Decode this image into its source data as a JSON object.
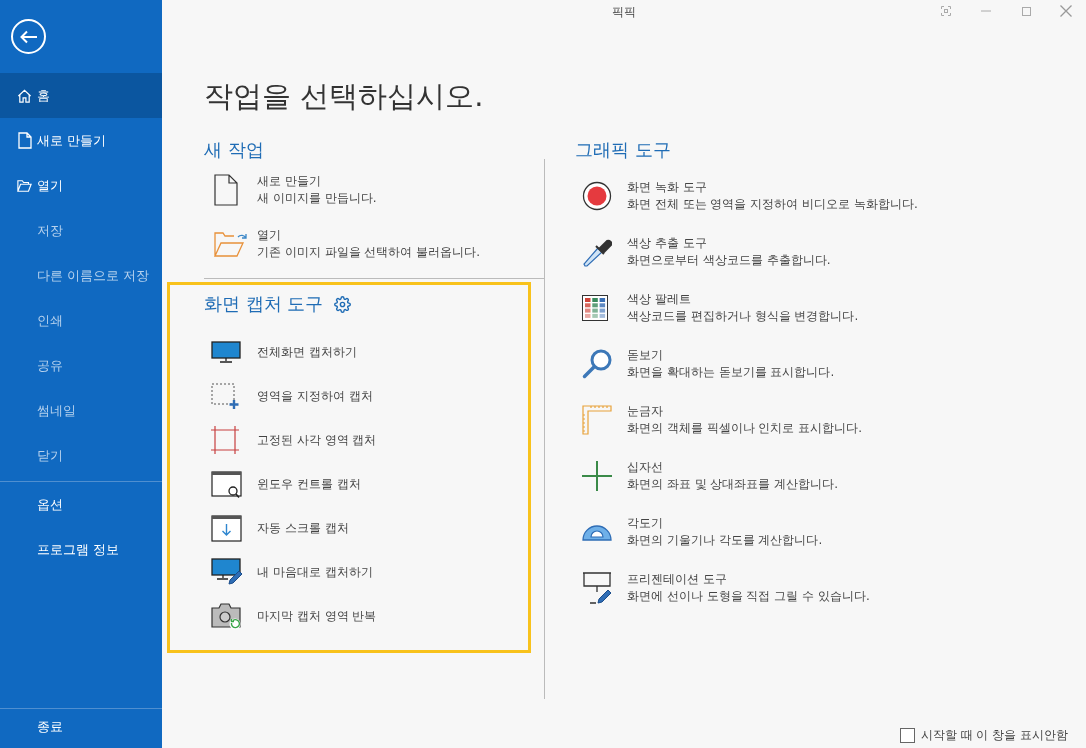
{
  "window": {
    "title": "픽픽"
  },
  "sidebar": {
    "items": [
      {
        "label": "홈",
        "kind": "home",
        "selected": true,
        "disabled": false
      },
      {
        "label": "새로 만들기",
        "kind": "file",
        "selected": false,
        "disabled": false
      },
      {
        "label": "열기",
        "kind": "folder",
        "selected": false,
        "disabled": false
      },
      {
        "label": "저장",
        "kind": "plain",
        "selected": false,
        "disabled": true
      },
      {
        "label": "다른 이름으로 저장",
        "kind": "plain",
        "selected": false,
        "disabled": true
      },
      {
        "label": "인쇄",
        "kind": "plain",
        "selected": false,
        "disabled": true
      },
      {
        "label": "공유",
        "kind": "plain",
        "selected": false,
        "disabled": true
      },
      {
        "label": "썸네일",
        "kind": "plain",
        "selected": false,
        "disabled": true
      },
      {
        "label": "닫기",
        "kind": "plain",
        "selected": false,
        "disabled": true
      },
      {
        "label": "옵션",
        "kind": "divided",
        "selected": false,
        "disabled": false
      },
      {
        "label": "프로그램 정보",
        "kind": "plain",
        "selected": false,
        "disabled": false
      }
    ],
    "exit": "종료"
  },
  "heading": "작업을 선택하십시오.",
  "new_task": {
    "title": "새 작업",
    "items": [
      {
        "kind": "file",
        "title": "새로 만들기",
        "description": "새 이미지를 만듭니다."
      },
      {
        "kind": "folder",
        "title": "열기",
        "description": "기존 이미지 파일을 선택하여 불러옵니다."
      }
    ]
  },
  "capture_tools": {
    "title": "화면 캡처 도구",
    "items": [
      {
        "kind": "monitor",
        "label": "전체화면 캡처하기"
      },
      {
        "kind": "region",
        "label": "영역을 지정하여 캡처"
      },
      {
        "kind": "fixed",
        "label": "고정된 사각 영역 캡처"
      },
      {
        "kind": "window",
        "label": "윈도우 컨트롤 캡처"
      },
      {
        "kind": "scroll",
        "label": "자동 스크롤 캡처"
      },
      {
        "kind": "freehand",
        "label": "내 마음대로 캡처하기"
      },
      {
        "kind": "repeat",
        "label": "마지막 캡처 영역 반복"
      }
    ]
  },
  "graphic_tools": {
    "title": "그래픽 도구",
    "items": [
      {
        "kind": "record",
        "title": "화면 녹화 도구",
        "description": "화면 전체 또는 영역을 지정하여 비디오로 녹화합니다."
      },
      {
        "kind": "picker",
        "title": "색상 추출 도구",
        "description": "화면으로부터 색상코드를 추출합니다."
      },
      {
        "kind": "palette",
        "title": "색상 팔레트",
        "description": "색상코드를 편집하거나 형식을 변경합니다."
      },
      {
        "kind": "magnifier",
        "title": "돋보기",
        "description": "화면을 확대하는 돋보기를 표시합니다."
      },
      {
        "kind": "ruler",
        "title": "눈금자",
        "description": "화면의 객체를 픽셀이나 인치로 표시합니다."
      },
      {
        "kind": "crosshair",
        "title": "십자선",
        "description": "화면의 좌표 및 상대좌표를 계산합니다."
      },
      {
        "kind": "protractor",
        "title": "각도기",
        "description": "화면의 기울기나 각도를 계산합니다."
      },
      {
        "kind": "presentation",
        "title": "프리젠테이션 도구",
        "description": "화면에 선이나 도형을 직접 그릴 수 있습니다."
      }
    ]
  },
  "startup_checkbox": {
    "label": "시작할 때 이 창을 표시안함",
    "checked": false
  }
}
